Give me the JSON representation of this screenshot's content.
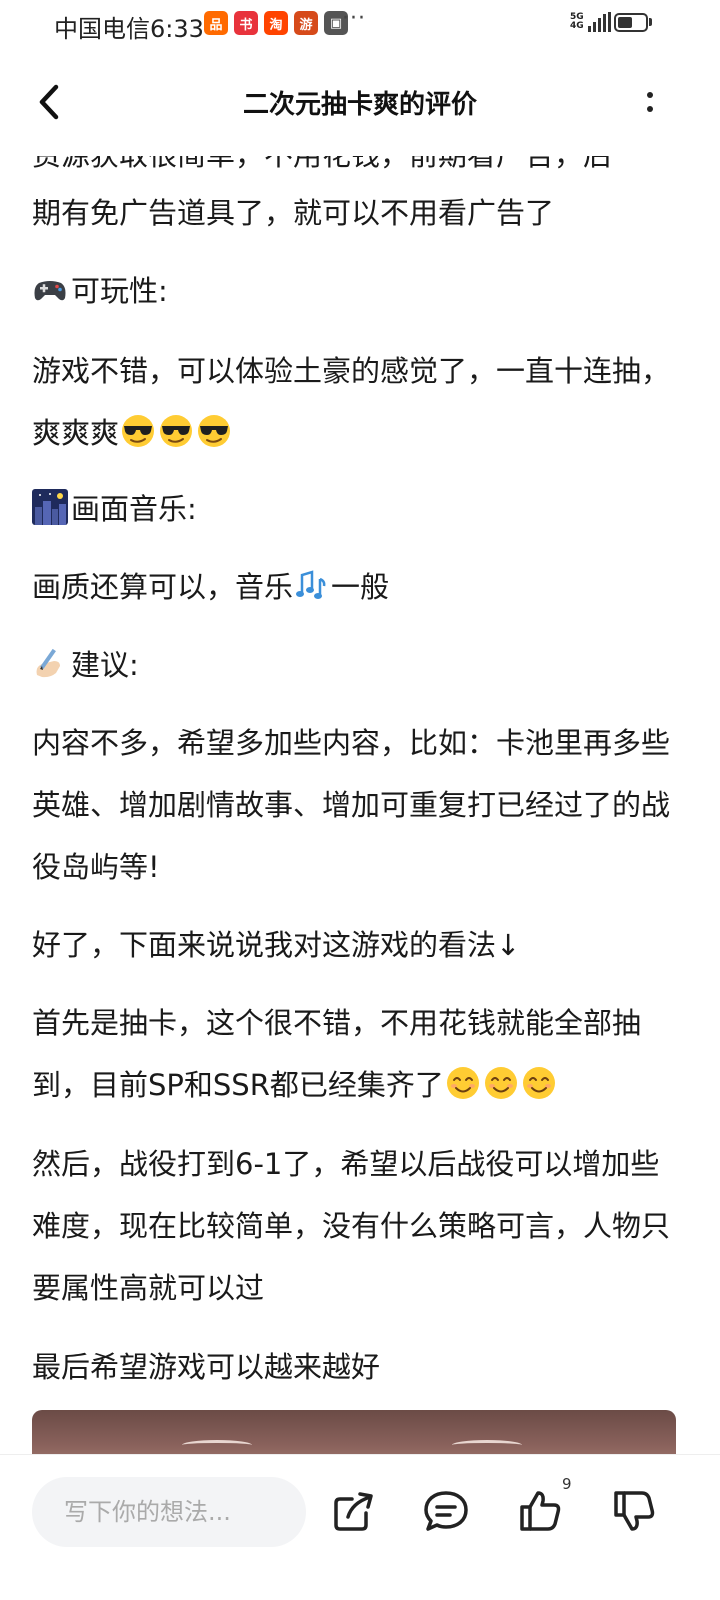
{
  "status_bar": {
    "carrier": "中国电信",
    "time": "6:33",
    "network": "5G",
    "network_sub": "4G",
    "apps": [
      {
        "icon": "app-orange-icon",
        "glyph": "品",
        "color": "#ff6a00"
      },
      {
        "icon": "app-red-book-icon",
        "glyph": "书",
        "color": "#e8333c"
      },
      {
        "icon": "taobao-icon",
        "glyph": "淘",
        "color": "#ff4400"
      },
      {
        "icon": "app-game-icon",
        "glyph": "游",
        "color": "#d64a1a"
      },
      {
        "icon": "app-gray-icon",
        "glyph": "▣",
        "color": "#555555"
      }
    ],
    "more_dots": "···"
  },
  "header": {
    "title": "二次元抽卡爽的评价"
  },
  "article": {
    "cut_line": "资源获取很简单，不用花钱，前期看广告，后",
    "paragraphs": [
      {
        "id": "p0",
        "text": "期有免广告道具了，就可以不用看广告了"
      },
      {
        "id": "p1",
        "icon": "game-controller-icon",
        "text": "可玩性:"
      },
      {
        "id": "p2",
        "text": "游戏不错，可以体验土豪的感觉了，一直十连抽，爽爽爽",
        "trail_icon": "sunglasses-emoji-icon",
        "trail_count": 3
      },
      {
        "id": "p3",
        "icon": "night-city-icon",
        "text": "画面音乐:"
      },
      {
        "id": "p4",
        "text": "画质还算可以，音乐",
        "mid_icon": "music-notes-icon",
        "text_after": "一般"
      },
      {
        "id": "p5",
        "icon": "writing-hand-icon",
        "text": "建议:"
      },
      {
        "id": "p6",
        "text": "内容不多，希望多加些内容，比如：卡池里再多些英雄、增加剧情故事、增加可重复打已经过了的战役岛屿等!"
      },
      {
        "id": "p7",
        "text": "好了，下面来说说我对这游戏的看法↓"
      },
      {
        "id": "p8",
        "text": "首先是抽卡，这个很不错，不用花钱就能全部抽到，目前SP和SSR都已经集齐了",
        "trail_icon": "smiling-face-icon",
        "trail_count": 3
      },
      {
        "id": "p9",
        "text": "然后，战役打到6-1了，希望以后战役可以增加些难度，现在比较简单，没有什么策略可言，人物只要属性高就可以过"
      },
      {
        "id": "p10",
        "text": "最后希望游戏可以越来越好"
      }
    ]
  },
  "bottom_bar": {
    "comment_placeholder": "写下你的想法...",
    "like_count": "9"
  }
}
